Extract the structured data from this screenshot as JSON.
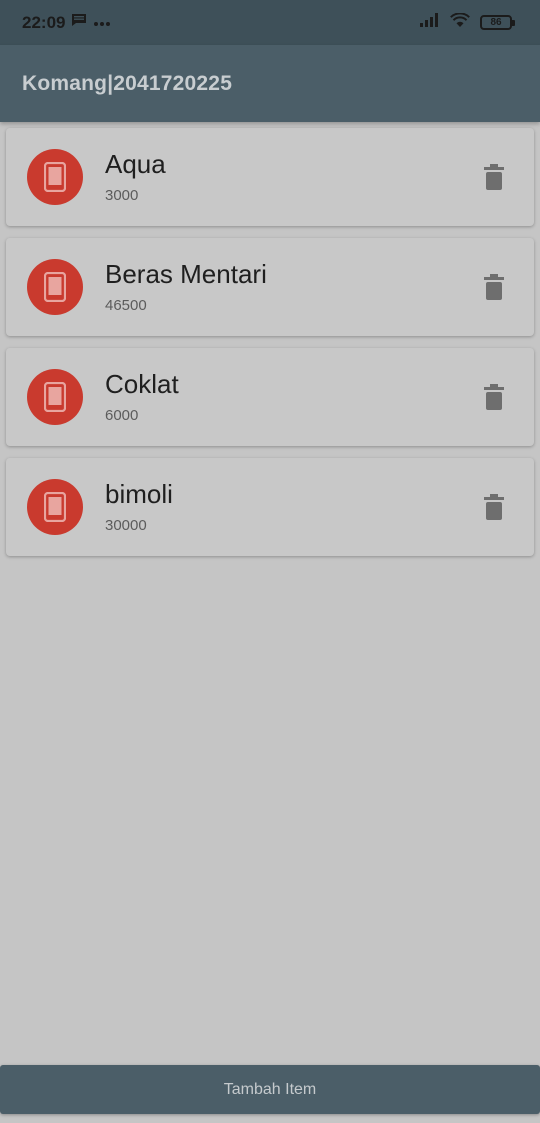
{
  "status_bar": {
    "time": "22:09",
    "battery": "86",
    "icons": [
      "message-icon",
      "more-dots-icon",
      "signal-icon",
      "wifi-icon",
      "battery-icon"
    ]
  },
  "app_bar": {
    "title": "Komang|2041720225"
  },
  "items": [
    {
      "name": "Aqua",
      "price": "3000",
      "icon": "phone-device-icon"
    },
    {
      "name": "Beras Mentari",
      "price": "46500",
      "icon": "phone-device-icon"
    },
    {
      "name": "Coklat",
      "price": "6000",
      "icon": "phone-device-icon"
    },
    {
      "name": "bimoli",
      "price": "30000",
      "icon": "phone-device-icon"
    }
  ],
  "footer": {
    "add_button_label": "Tambah Item"
  },
  "colors": {
    "app_bar": "#4b5e68",
    "status_bar": "#3e5059",
    "background": "#c5c5c5",
    "avatar": "#c93a2e",
    "delete_icon": "#6e6e6e"
  }
}
